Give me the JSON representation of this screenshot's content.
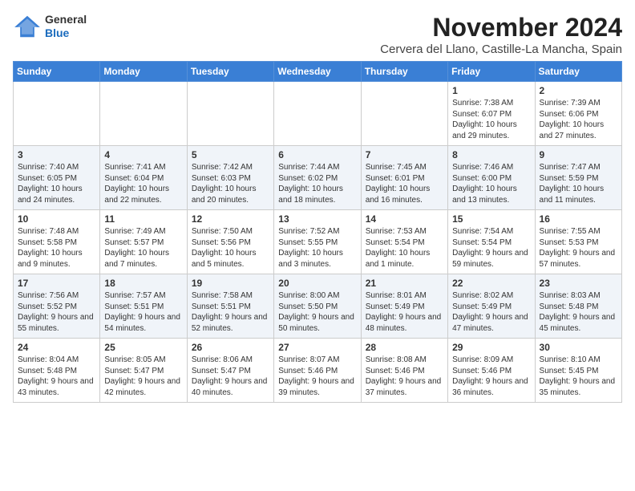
{
  "logo": {
    "line1": "General",
    "line2": "Blue"
  },
  "header": {
    "month": "November 2024",
    "location": "Cervera del Llano, Castille-La Mancha, Spain"
  },
  "weekdays": [
    "Sunday",
    "Monday",
    "Tuesday",
    "Wednesday",
    "Thursday",
    "Friday",
    "Saturday"
  ],
  "weeks": [
    [
      {
        "day": "",
        "info": ""
      },
      {
        "day": "",
        "info": ""
      },
      {
        "day": "",
        "info": ""
      },
      {
        "day": "",
        "info": ""
      },
      {
        "day": "",
        "info": ""
      },
      {
        "day": "1",
        "info": "Sunrise: 7:38 AM\nSunset: 6:07 PM\nDaylight: 10 hours and 29 minutes."
      },
      {
        "day": "2",
        "info": "Sunrise: 7:39 AM\nSunset: 6:06 PM\nDaylight: 10 hours and 27 minutes."
      }
    ],
    [
      {
        "day": "3",
        "info": "Sunrise: 7:40 AM\nSunset: 6:05 PM\nDaylight: 10 hours and 24 minutes."
      },
      {
        "day": "4",
        "info": "Sunrise: 7:41 AM\nSunset: 6:04 PM\nDaylight: 10 hours and 22 minutes."
      },
      {
        "day": "5",
        "info": "Sunrise: 7:42 AM\nSunset: 6:03 PM\nDaylight: 10 hours and 20 minutes."
      },
      {
        "day": "6",
        "info": "Sunrise: 7:44 AM\nSunset: 6:02 PM\nDaylight: 10 hours and 18 minutes."
      },
      {
        "day": "7",
        "info": "Sunrise: 7:45 AM\nSunset: 6:01 PM\nDaylight: 10 hours and 16 minutes."
      },
      {
        "day": "8",
        "info": "Sunrise: 7:46 AM\nSunset: 6:00 PM\nDaylight: 10 hours and 13 minutes."
      },
      {
        "day": "9",
        "info": "Sunrise: 7:47 AM\nSunset: 5:59 PM\nDaylight: 10 hours and 11 minutes."
      }
    ],
    [
      {
        "day": "10",
        "info": "Sunrise: 7:48 AM\nSunset: 5:58 PM\nDaylight: 10 hours and 9 minutes."
      },
      {
        "day": "11",
        "info": "Sunrise: 7:49 AM\nSunset: 5:57 PM\nDaylight: 10 hours and 7 minutes."
      },
      {
        "day": "12",
        "info": "Sunrise: 7:50 AM\nSunset: 5:56 PM\nDaylight: 10 hours and 5 minutes."
      },
      {
        "day": "13",
        "info": "Sunrise: 7:52 AM\nSunset: 5:55 PM\nDaylight: 10 hours and 3 minutes."
      },
      {
        "day": "14",
        "info": "Sunrise: 7:53 AM\nSunset: 5:54 PM\nDaylight: 10 hours and 1 minute."
      },
      {
        "day": "15",
        "info": "Sunrise: 7:54 AM\nSunset: 5:54 PM\nDaylight: 9 hours and 59 minutes."
      },
      {
        "day": "16",
        "info": "Sunrise: 7:55 AM\nSunset: 5:53 PM\nDaylight: 9 hours and 57 minutes."
      }
    ],
    [
      {
        "day": "17",
        "info": "Sunrise: 7:56 AM\nSunset: 5:52 PM\nDaylight: 9 hours and 55 minutes."
      },
      {
        "day": "18",
        "info": "Sunrise: 7:57 AM\nSunset: 5:51 PM\nDaylight: 9 hours and 54 minutes."
      },
      {
        "day": "19",
        "info": "Sunrise: 7:58 AM\nSunset: 5:51 PM\nDaylight: 9 hours and 52 minutes."
      },
      {
        "day": "20",
        "info": "Sunrise: 8:00 AM\nSunset: 5:50 PM\nDaylight: 9 hours and 50 minutes."
      },
      {
        "day": "21",
        "info": "Sunrise: 8:01 AM\nSunset: 5:49 PM\nDaylight: 9 hours and 48 minutes."
      },
      {
        "day": "22",
        "info": "Sunrise: 8:02 AM\nSunset: 5:49 PM\nDaylight: 9 hours and 47 minutes."
      },
      {
        "day": "23",
        "info": "Sunrise: 8:03 AM\nSunset: 5:48 PM\nDaylight: 9 hours and 45 minutes."
      }
    ],
    [
      {
        "day": "24",
        "info": "Sunrise: 8:04 AM\nSunset: 5:48 PM\nDaylight: 9 hours and 43 minutes."
      },
      {
        "day": "25",
        "info": "Sunrise: 8:05 AM\nSunset: 5:47 PM\nDaylight: 9 hours and 42 minutes."
      },
      {
        "day": "26",
        "info": "Sunrise: 8:06 AM\nSunset: 5:47 PM\nDaylight: 9 hours and 40 minutes."
      },
      {
        "day": "27",
        "info": "Sunrise: 8:07 AM\nSunset: 5:46 PM\nDaylight: 9 hours and 39 minutes."
      },
      {
        "day": "28",
        "info": "Sunrise: 8:08 AM\nSunset: 5:46 PM\nDaylight: 9 hours and 37 minutes."
      },
      {
        "day": "29",
        "info": "Sunrise: 8:09 AM\nSunset: 5:46 PM\nDaylight: 9 hours and 36 minutes."
      },
      {
        "day": "30",
        "info": "Sunrise: 8:10 AM\nSunset: 5:45 PM\nDaylight: 9 hours and 35 minutes."
      }
    ]
  ]
}
